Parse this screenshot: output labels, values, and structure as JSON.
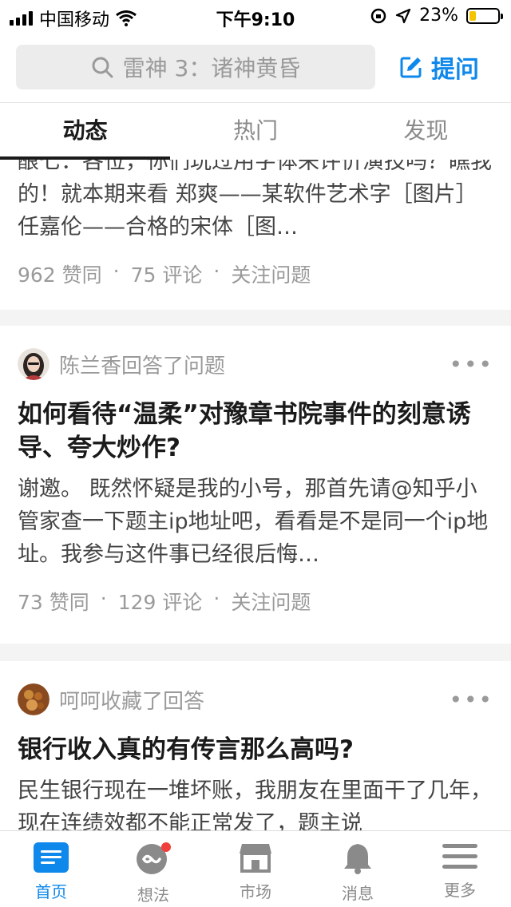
{
  "status_bar": {
    "carrier": "中国移动",
    "time": "下午9:10",
    "battery": "23%",
    "battery_fraction": 0.23
  },
  "search": {
    "placeholder": "雷神 3：诸神黄昏",
    "ask_label": "提问"
  },
  "tabs": [
    {
      "label": "动态",
      "active": true
    },
    {
      "label": "热门",
      "active": false
    },
    {
      "label": "发现",
      "active": false
    }
  ],
  "feed": [
    {
      "excerpt": "酿七：各位，你们玩过用字体来评价演技吗？瞧我的！就本期来看 郑爽——某软件艺术字［图片］任嘉伦——合格的宋体［图…",
      "meta": {
        "votes": "962 赞同",
        "comments": "75 评论",
        "follow": "关注问题"
      }
    },
    {
      "actor": "陈兰香回答了问题",
      "more": "•••",
      "title": "如何看待“温柔”对豫章书院事件的刻意诱导、夸大炒作?",
      "excerpt": "谢邀。 既然怀疑是我的小号，那首先请@知乎小管家查一下题主ip地址吧，看看是不是同一个ip地址。我参与这件事已经很后悔…",
      "meta": {
        "votes": "73 赞同",
        "comments": "129 评论",
        "follow": "关注问题"
      }
    },
    {
      "actor": "呵呵收藏了回答",
      "more": "•••",
      "title": "银行收入真的有传言那么高吗?",
      "excerpt": "民生银行现在一堆坏账，我朋友在里面干了几年，现在连绩效都不能正常发了，题主说"
    }
  ],
  "bottom_nav": [
    {
      "label": "首页",
      "icon": "home-icon",
      "active": true
    },
    {
      "label": "想法",
      "icon": "ideas-icon",
      "active": false,
      "badge": true
    },
    {
      "label": "市场",
      "icon": "market-icon",
      "active": false
    },
    {
      "label": "消息",
      "icon": "bell-icon",
      "active": false
    },
    {
      "label": "更多",
      "icon": "menu-icon",
      "active": false
    }
  ],
  "colors": {
    "accent": "#0f88eb",
    "badge": "#f1403c",
    "battery": "#f5c400"
  }
}
